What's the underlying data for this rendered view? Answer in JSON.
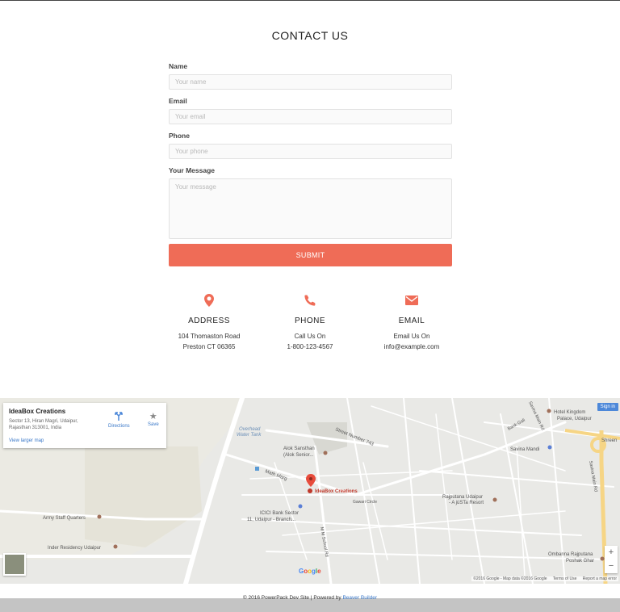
{
  "contact": {
    "title": "CONTACT US",
    "name_label": "Name",
    "name_placeholder": "Your name",
    "email_label": "Email",
    "email_placeholder": "Your email",
    "phone_label": "Phone",
    "phone_placeholder": "Your phone",
    "message_label": "Your Message",
    "message_placeholder": "Your message",
    "submit_label": "SUBMIT"
  },
  "info": {
    "address": {
      "title": "ADDRESS",
      "line1": "104 Thomaston Road",
      "line2": "Preston CT 06365",
      "icon": "map-marker-icon"
    },
    "phone": {
      "title": "PHONE",
      "line1": "Call Us On",
      "line2": "1-800-123-4567",
      "icon": "phone-icon"
    },
    "email": {
      "title": "EMAIL",
      "line1": "Email Us On",
      "line2": "info@example.com",
      "icon": "envelope-icon"
    },
    "accent": "#ef6c57"
  },
  "map": {
    "place_name": "IdeaBox Creations",
    "place_address": "Sector 13, Hiran Magri, Udaipur, Rajasthan 313001, India",
    "directions_label": "Directions",
    "save_label": "Save",
    "view_larger": "View larger map",
    "sign_in": "Sign in",
    "zoom_in": "+",
    "zoom_out": "−",
    "google_logo": "Google",
    "attribution": "©2016 Google - Map data ©2016 Google",
    "terms": "Terms of Use",
    "report": "Report a map error",
    "labels": {
      "overhead": "Overhead",
      "water_tank": "Water Tank",
      "street_743": "Street Number 743",
      "alok1": "Alok Sansthan",
      "alok2": "(Alok Senior...",
      "math_marg": "Math Marg",
      "marker": "IdeaBox Creations",
      "gawari": "Gawari Circle",
      "icici1": "ICICI Bank Sector",
      "icici2": "11, Udaipur - Branch...",
      "army": "Army Staff Quarters",
      "inder": "Inder Residency Udaipur",
      "mm_school": "M M School Rd",
      "raj1": "Rajputana Udaipur",
      "raj2": "- A jüSTa Resort",
      "hotel1": "Hotel Kingdom",
      "hotel2": "Palace, Udaipur",
      "savina_mandi": "Savina Mandi",
      "savina_main": "Savina Main Rd",
      "savina_main_rd": "Savina Main Rd",
      "bank_gali": "Bank Gali",
      "shreen": "Shreen",
      "ombanna1": "Ombanna Rajputana",
      "ombanna2": "Poshak Ghar"
    }
  },
  "footer": {
    "text": "© 2016 PowerPack Dev Site | Powered by",
    "link": "Beaver Builder"
  }
}
